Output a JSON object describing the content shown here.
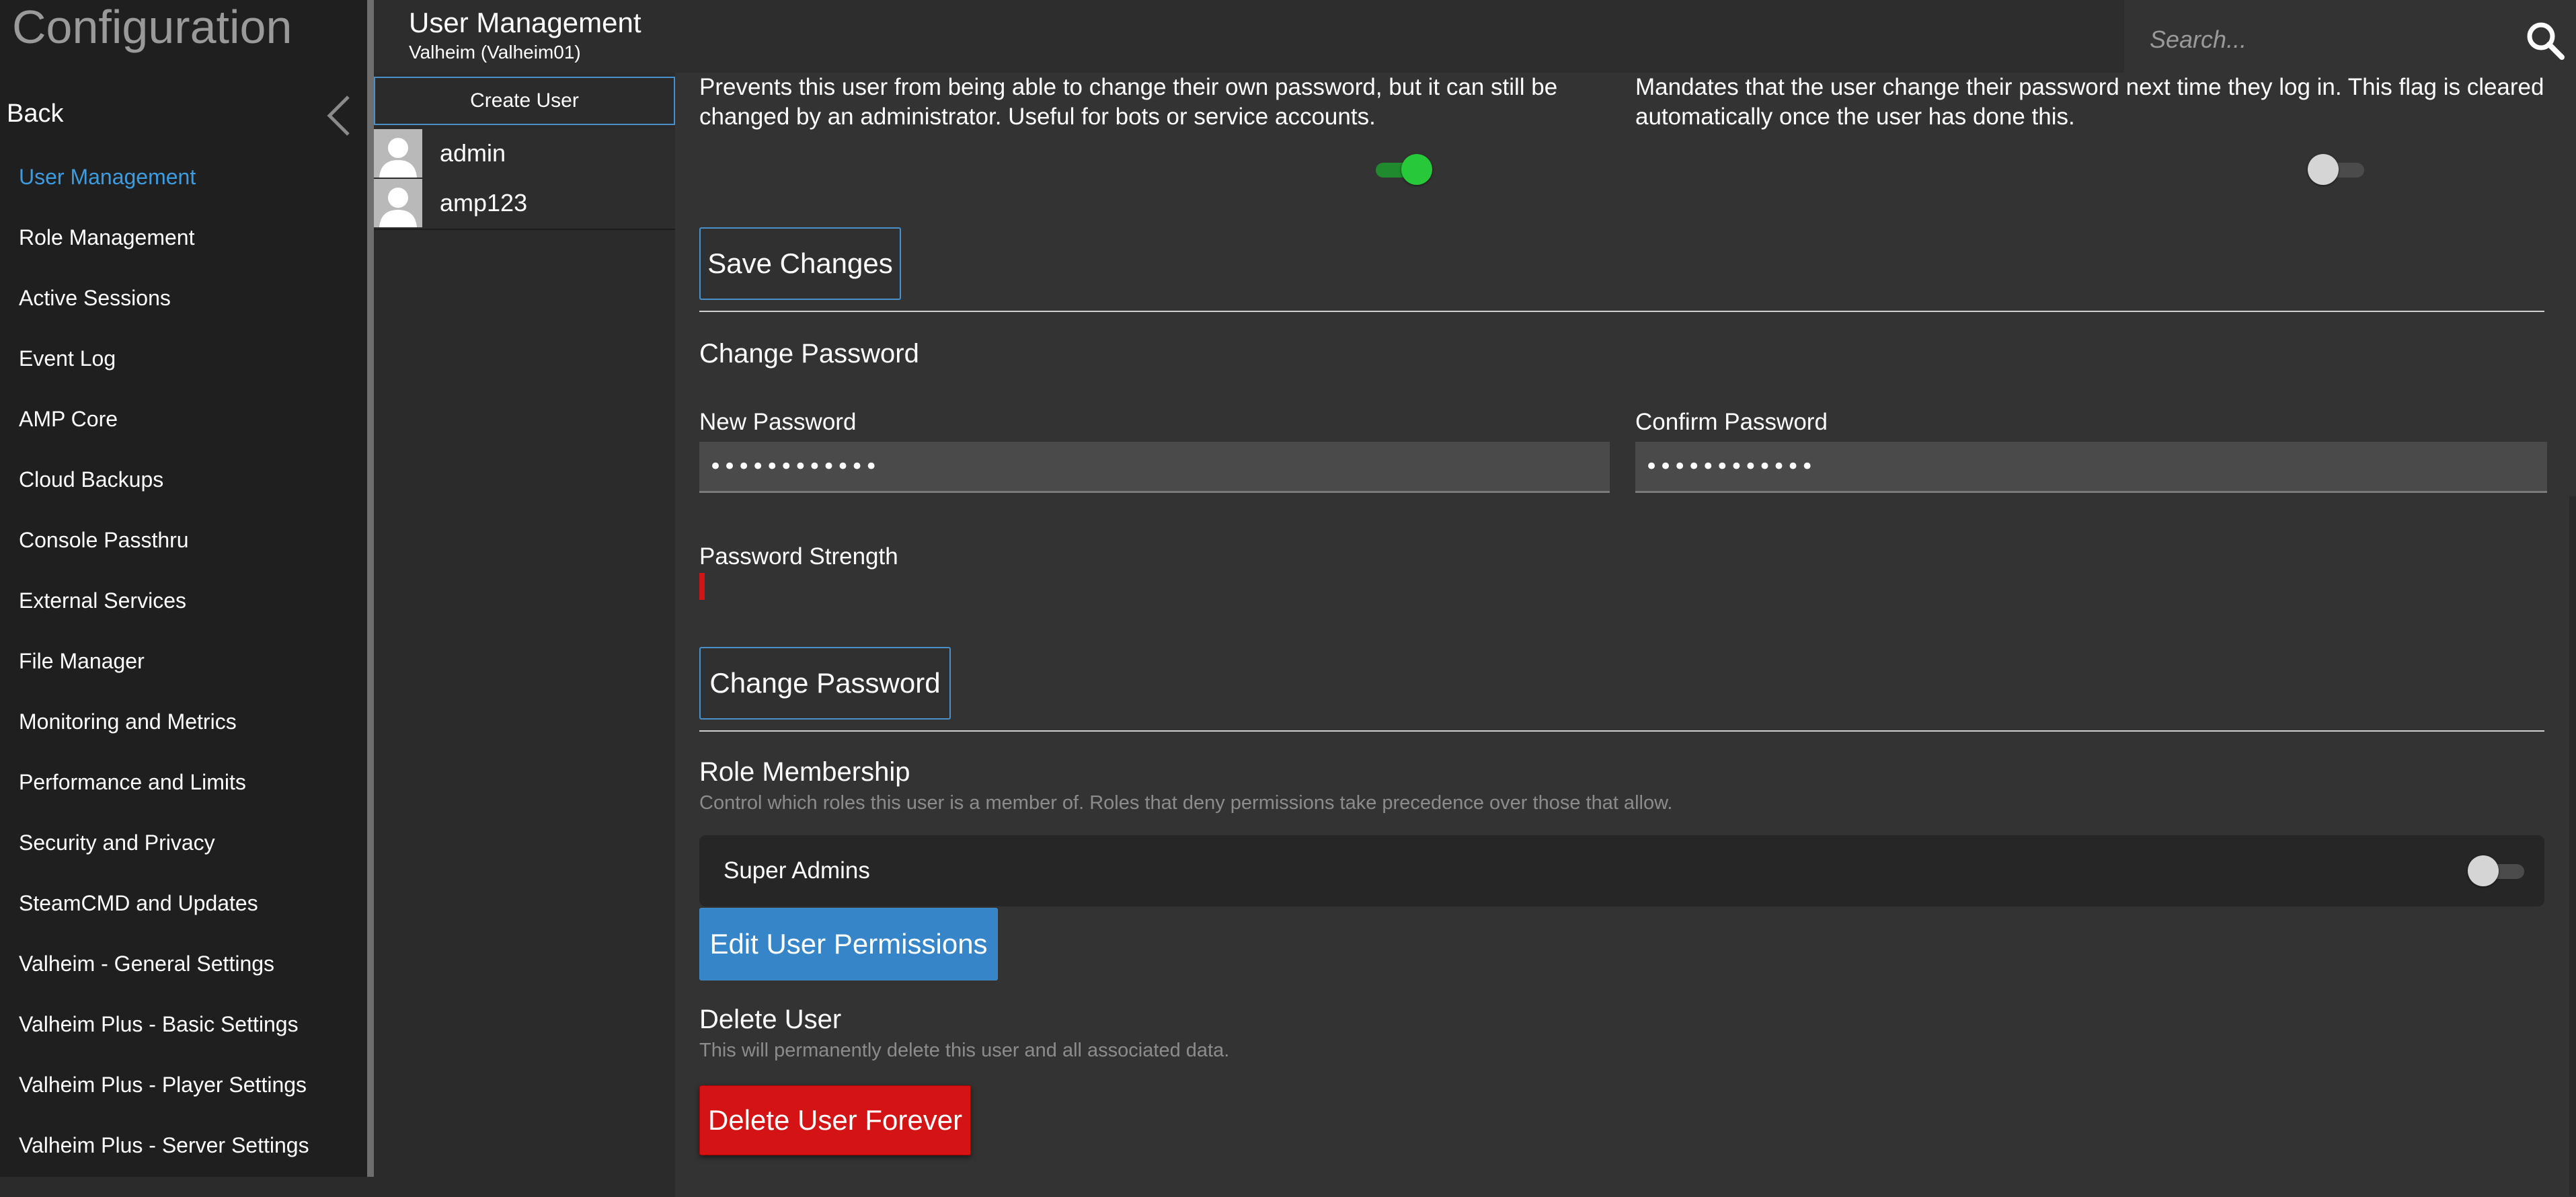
{
  "nav": {
    "title": "Configuration",
    "back_label": "Back",
    "items": [
      {
        "label": "User Management"
      },
      {
        "label": "Role Management"
      },
      {
        "label": "Active Sessions"
      },
      {
        "label": "Event Log"
      },
      {
        "label": "AMP Core"
      },
      {
        "label": "Cloud Backups"
      },
      {
        "label": "Console Passthru"
      },
      {
        "label": "External Services"
      },
      {
        "label": "File Manager"
      },
      {
        "label": "Monitoring and Metrics"
      },
      {
        "label": "Performance and Limits"
      },
      {
        "label": "Security and Privacy"
      },
      {
        "label": "SteamCMD and Updates"
      },
      {
        "label": "Valheim - General Settings"
      },
      {
        "label": "Valheim Plus - Basic Settings"
      },
      {
        "label": "Valheim Plus - Player Settings"
      },
      {
        "label": "Valheim Plus - Server Settings"
      }
    ],
    "active_item": "User Management"
  },
  "header": {
    "title": "User Management",
    "subtitle": "Valheim (Valheim01)",
    "search_placeholder": "Search..."
  },
  "users": {
    "create_label": "Create User",
    "list": [
      {
        "name": "admin"
      },
      {
        "name": "amp123"
      }
    ]
  },
  "settings": {
    "cannot_change_password": {
      "description": "Prevents this user from being able to change their own password, but it can still be changed by an administrator. Useful for bots or service accounts.",
      "enabled": true
    },
    "must_change_password": {
      "description": "Mandates that the user change their password next time they log in. This flag is cleared automatically once the user has done this.",
      "enabled": false
    },
    "save_label": "Save Changes"
  },
  "change_password": {
    "title": "Change Password",
    "new_label": "New Password",
    "new_value": "••••••••••••",
    "confirm_label": "Confirm Password",
    "confirm_value": "••••••••••••",
    "strength_label": "Password Strength",
    "strength_fraction": 0.003,
    "button_label": "Change Password"
  },
  "roles": {
    "title": "Role Membership",
    "description": "Control which roles this user is a member of. Roles that deny permissions take precedence over those that allow.",
    "items": [
      {
        "name": "Super Admins",
        "member": false
      }
    ],
    "edit_permissions_label": "Edit User Permissions"
  },
  "delete": {
    "title": "Delete User",
    "description": "This will permanently delete this user and all associated data.",
    "button_label": "Delete User Forever"
  },
  "colors": {
    "accent": "#3d9be0",
    "toggle_on": "#27c83a",
    "danger": "#d41414",
    "primary_button": "#3585c8"
  }
}
